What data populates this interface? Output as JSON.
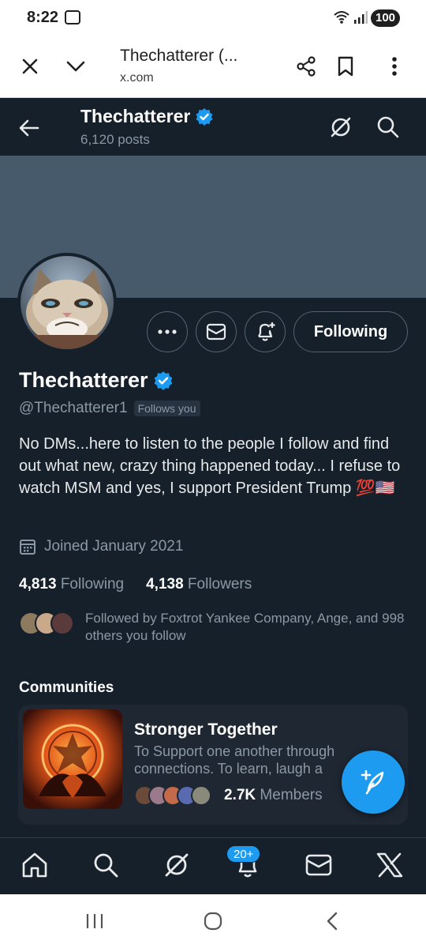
{
  "status_bar": {
    "time": "8:22",
    "battery": "100"
  },
  "browser": {
    "title": "Thechatterer (...",
    "url": "x.com"
  },
  "header": {
    "name": "Thechatterer",
    "posts": "6,120 posts"
  },
  "profile": {
    "name": "Thechatterer",
    "handle": "@Thechatterer1",
    "follows_you": "Follows you",
    "follow_button": "Following",
    "bio": "No DMs...here to listen to the people I follow and find out what new, crazy thing happened today... I refuse to watch MSM and yes, I support President Trump 💯🇺🇸",
    "joined": "Joined January 2021",
    "following_count": "4,813",
    "following_label": "Following",
    "followers_count": "4,138",
    "followers_label": "Followers",
    "followed_by": "Followed by Foxtrot Yankee Company, Ange, and 998 others you follow"
  },
  "communities": {
    "heading": "Communities",
    "card": {
      "name": "Stronger Together",
      "description": "To Support one another through connections. To learn, laugh a",
      "members_count": "2.7K",
      "members_label": "Members"
    }
  },
  "bottom_nav": {
    "notifications_badge": "20+"
  },
  "colors": {
    "background": "#15202b",
    "accent": "#1d9bf0",
    "banner": "#475a6c",
    "secondary_text": "#8b98a5"
  },
  "icons": [
    "close-icon",
    "chevron-down-icon",
    "share-icon",
    "bookmark-icon",
    "more-vert-icon",
    "back-arrow-icon",
    "verified-icon",
    "grok-icon",
    "search-icon",
    "more-horizontal-icon",
    "message-icon",
    "notification-plus-icon",
    "calendar-icon",
    "home-icon",
    "bell-icon",
    "mail-icon",
    "x-logo-icon",
    "compose-icon"
  ]
}
